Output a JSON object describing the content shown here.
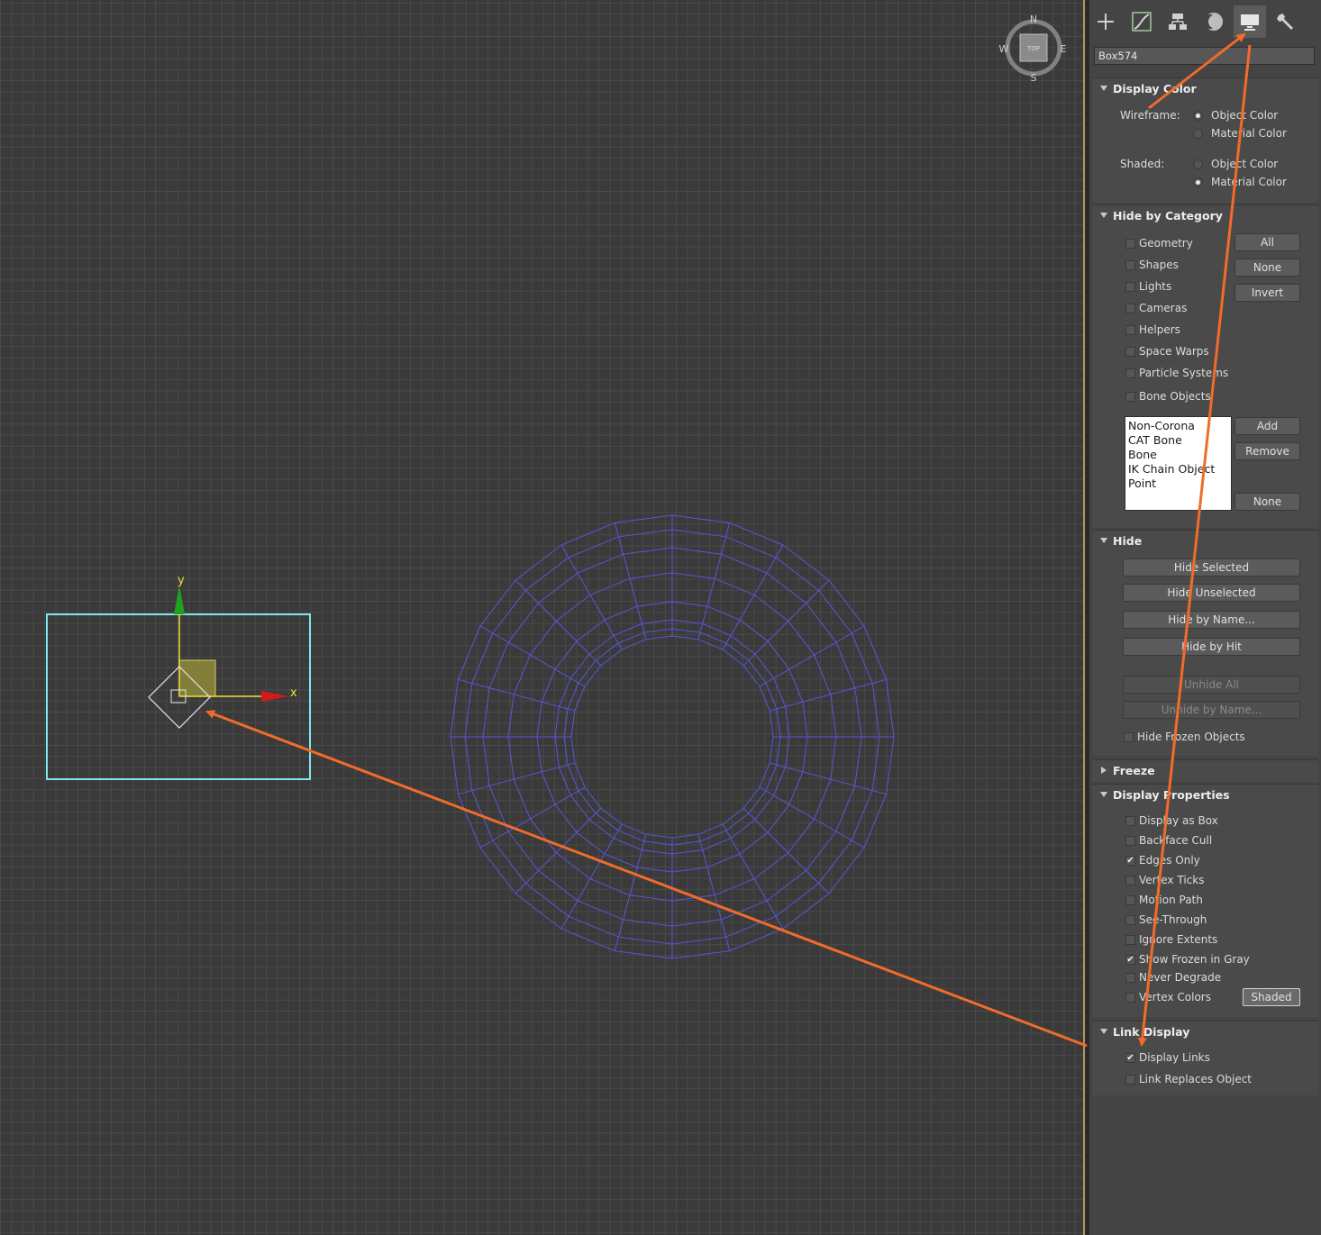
{
  "viewcube": {
    "n": "N",
    "s": "S",
    "e": "E",
    "w": "W",
    "face": "TOP"
  },
  "gizmo": {
    "x_label": "x",
    "y_label": "y"
  },
  "command_panel": {
    "tabs": [
      {
        "name": "create-tab",
        "icon": "plus-icon"
      },
      {
        "name": "modify-tab",
        "icon": "modify-curve-icon"
      },
      {
        "name": "hierarchy-tab",
        "icon": "hierarchy-icon"
      },
      {
        "name": "motion-tab",
        "icon": "motion-circle-icon"
      },
      {
        "name": "display-tab",
        "icon": "monitor-icon",
        "active": true
      },
      {
        "name": "utilities-tab",
        "icon": "wrench-icon"
      }
    ],
    "object_name": "Box574"
  },
  "display_color": {
    "title": "Display Color",
    "wireframe_label": "Wireframe:",
    "shaded_label": "Shaded:",
    "object_color": "Object Color",
    "material_color": "Material Color",
    "wireframe_selected": "object",
    "shaded_selected": "material"
  },
  "hide_by_category": {
    "title": "Hide by Category",
    "items": [
      "Geometry",
      "Shapes",
      "Lights",
      "Cameras",
      "Helpers",
      "Space Warps",
      "Particle Systems",
      "Bone Objects"
    ],
    "btn_all": "All",
    "btn_none": "None",
    "btn_invert": "Invert",
    "list": [
      "Non-Corona",
      "CAT Bone",
      "Bone",
      "IK Chain Object",
      "Point"
    ],
    "btn_add": "Add",
    "btn_remove": "Remove",
    "btn_none2": "None"
  },
  "hide": {
    "title": "Hide",
    "hide_selected": "Hide Selected",
    "hide_unselected": "Hide Unselected",
    "hide_by_name": "Hide by Name...",
    "hide_by_hit": "Hide by Hit",
    "unhide_all": "Unhide All",
    "unhide_by_name": "Unhide by Name...",
    "hide_frozen": "Hide Frozen Objects"
  },
  "freeze": {
    "title": "Freeze"
  },
  "display_properties": {
    "title": "Display Properties",
    "items": [
      {
        "label": "Display as Box",
        "checked": false
      },
      {
        "label": "Backface Cull",
        "checked": false
      },
      {
        "label": "Edges Only",
        "checked": true
      },
      {
        "label": "Vertex Ticks",
        "checked": false
      },
      {
        "label": "Motion Path",
        "checked": false
      },
      {
        "label": "See-Through",
        "checked": false
      },
      {
        "label": "Ignore Extents",
        "checked": false
      },
      {
        "label": "Show Frozen in Gray",
        "checked": true
      },
      {
        "label": "Never Degrade",
        "checked": false
      },
      {
        "label": "Vertex Colors",
        "checked": false
      }
    ],
    "shaded_button": "Shaded"
  },
  "link_display": {
    "title": "Link Display",
    "display_links": "Display Links",
    "display_links_checked": true,
    "link_replaces": "Link Replaces Object",
    "link_replaces_checked": false
  },
  "colors": {
    "annotation_arrow": "#f26b2a",
    "wireframe": "#5a55d8",
    "selection_box": "#7fe6f0"
  }
}
